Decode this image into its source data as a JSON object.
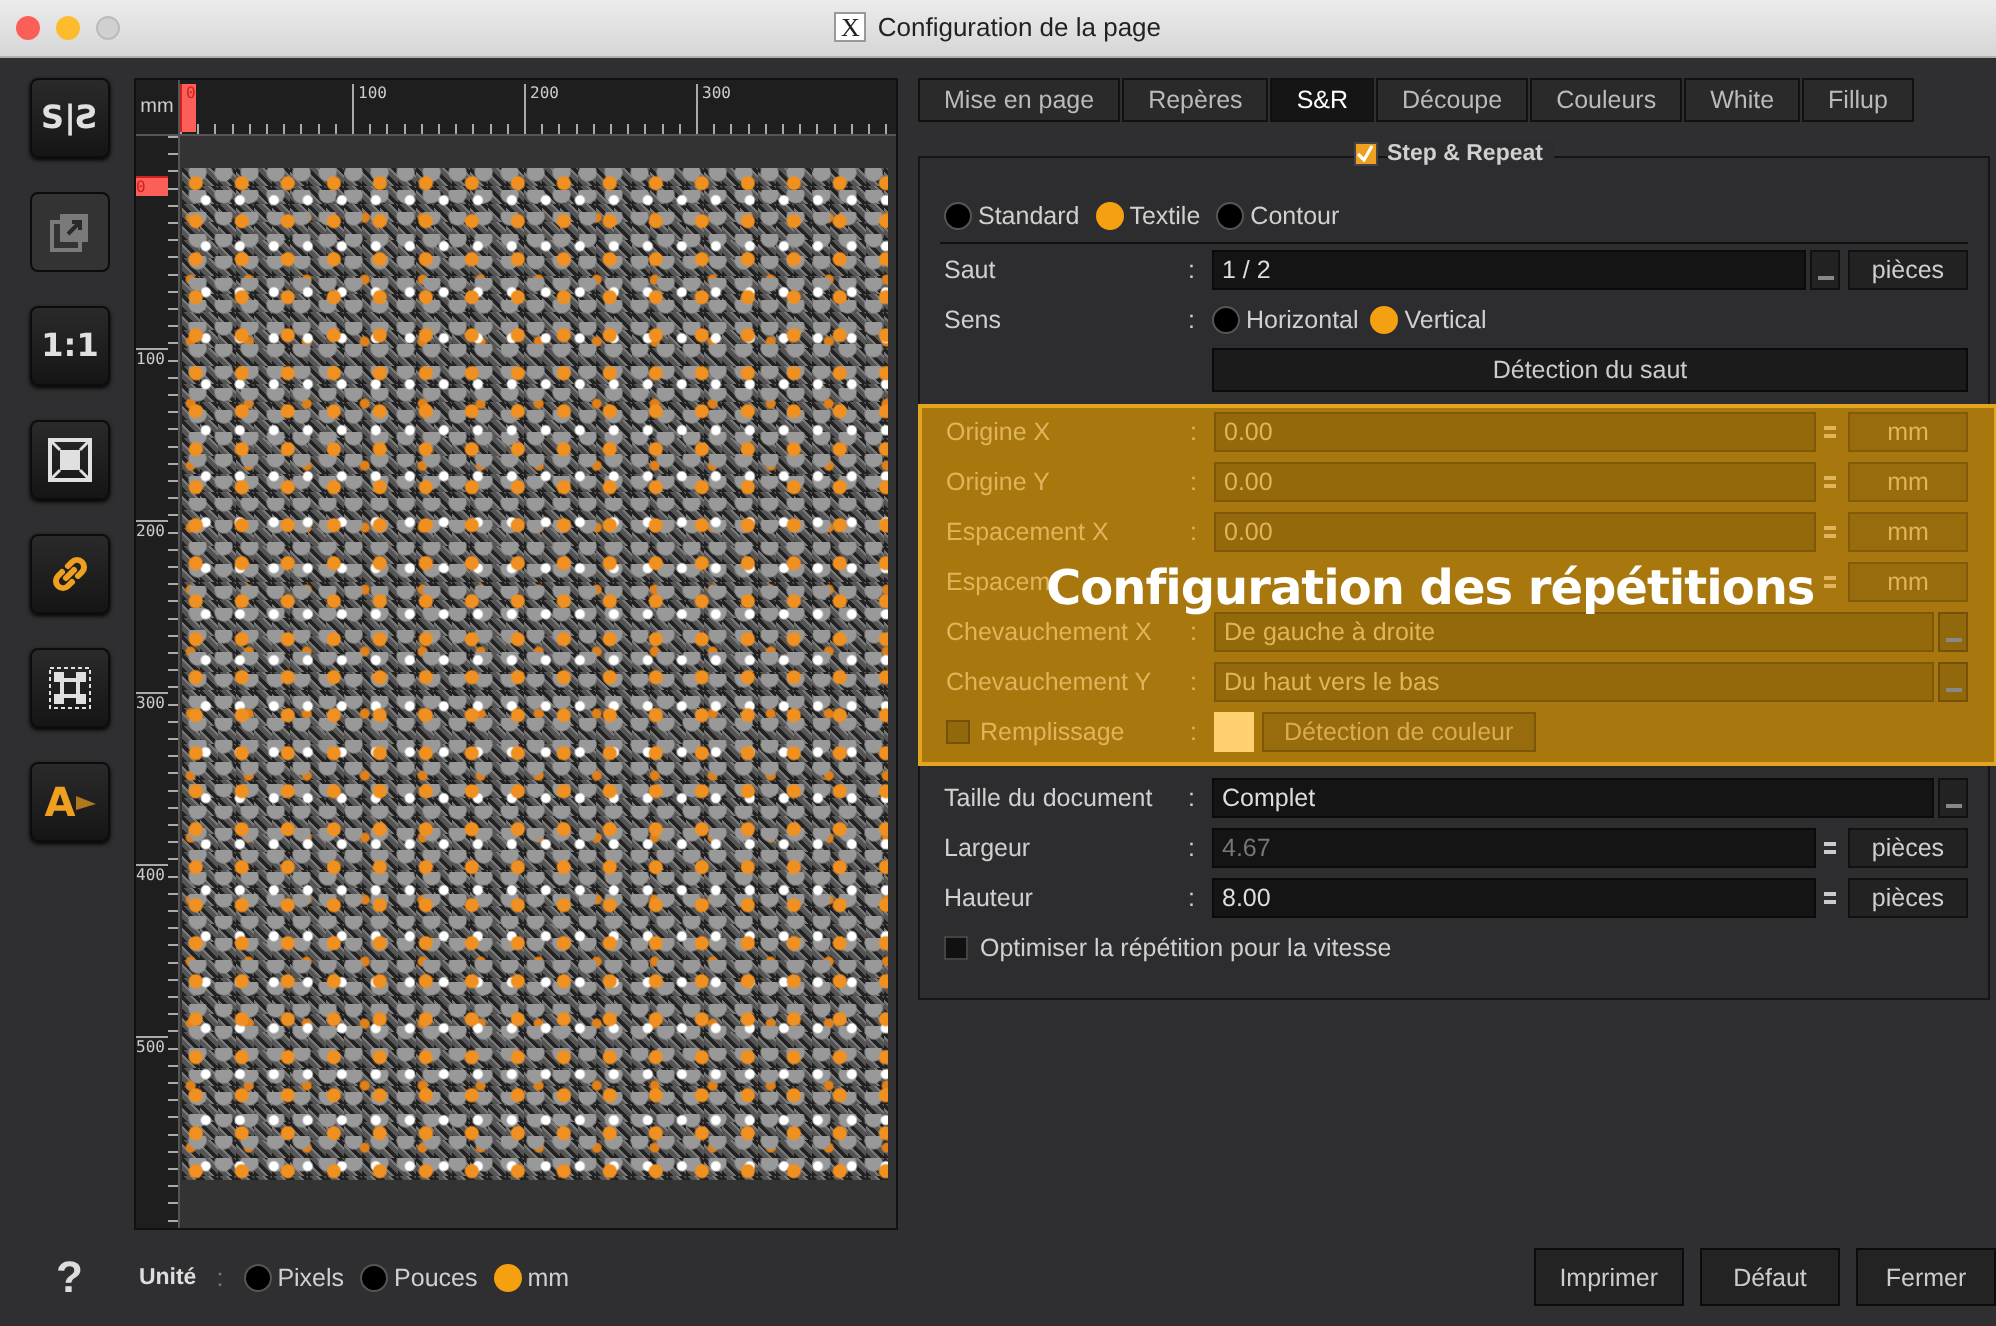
{
  "window": {
    "title": "Configuration de la page",
    "app_glyph": "X"
  },
  "toolbar": [
    {
      "kind": "mirror",
      "label": "S|Ƨ",
      "disabled": false,
      "on": false
    },
    {
      "kind": "export",
      "disabled": true,
      "on": false
    },
    {
      "kind": "actual",
      "label": "1:1",
      "disabled": false,
      "on": false
    },
    {
      "kind": "fit",
      "disabled": false,
      "on": false
    },
    {
      "kind": "link",
      "disabled": false,
      "on": true
    },
    {
      "kind": "frame",
      "disabled": false,
      "on": false
    },
    {
      "kind": "textlayer",
      "label": "A",
      "disabled": false,
      "on": true
    }
  ],
  "ruler": {
    "unit": "mm",
    "top_labels": [
      "0",
      "100",
      "200",
      "300"
    ],
    "left_labels": [
      "0",
      "100",
      "200",
      "300",
      "400",
      "500"
    ]
  },
  "tabs": [
    {
      "label": "Mise en page",
      "selected": false
    },
    {
      "label": "Repères",
      "selected": false
    },
    {
      "label": "S&R",
      "selected": true
    },
    {
      "label": "Découpe",
      "selected": false
    },
    {
      "label": "Couleurs",
      "selected": false
    },
    {
      "label": "White",
      "selected": false
    },
    {
      "label": "Fillup",
      "selected": false
    }
  ],
  "group": {
    "title": "Step & Repeat",
    "checked": true
  },
  "modes": [
    {
      "label": "Standard",
      "selected": false
    },
    {
      "label": "Textile",
      "selected": true
    },
    {
      "label": "Contour",
      "selected": false
    }
  ],
  "rows": [
    {
      "kind": "combo",
      "label": "Saut",
      "colon": ":",
      "value": "1 / 2",
      "unit": "pièces",
      "disabled": false
    },
    {
      "kind": "radios",
      "label": "Sens",
      "colon": ":",
      "options": [
        {
          "label": "Horizontal",
          "selected": false
        },
        {
          "label": "Vertical",
          "selected": true
        }
      ],
      "disabled": false
    },
    {
      "kind": "button",
      "label": "Détection du saut"
    }
  ],
  "highlight_rows": [
    {
      "kind": "spin",
      "label": "Origine X",
      "colon": ":",
      "value": "0.00",
      "unit": "mm",
      "disabled": true
    },
    {
      "kind": "spin",
      "label": "Origine Y",
      "colon": ":",
      "value": "0.00",
      "unit": "mm",
      "disabled": true
    },
    {
      "kind": "spin",
      "label": "Espacement X",
      "colon": ":",
      "value": "0.00",
      "unit": "mm",
      "disabled": true
    },
    {
      "kind": "spin",
      "label": "Espacem",
      "unit": "mm",
      "disabled": true
    },
    {
      "kind": "select",
      "label": "Chevauchement X",
      "colon": ":",
      "value": "De gauche à droite",
      "disabled": true
    },
    {
      "kind": "select",
      "label": "Chevauchement Y",
      "colon": ":",
      "value": "Du haut vers le bas",
      "disabled": true
    },
    {
      "kind": "fill",
      "label": "Remplissage",
      "colon": ":",
      "checked": false,
      "color": "#ffd070",
      "button": "Détection de couleur",
      "disabled": true
    }
  ],
  "callout": "Configuration des répétitions",
  "rows2": [
    {
      "kind": "select",
      "label": "Taille du document",
      "colon": ":",
      "value": "Complet",
      "disabled": false
    },
    {
      "kind": "spin",
      "label": "Largeur",
      "colon": ":",
      "value": "4.67",
      "unit": "pièces",
      "disabled": false,
      "readonly": true
    },
    {
      "kind": "spin",
      "label": "Hauteur",
      "colon": ":",
      "value": "8.00",
      "unit": "pièces",
      "disabled": false,
      "readonly": false
    },
    {
      "kind": "check",
      "label": "Optimiser la répétition pour la vitesse",
      "checked": false,
      "disabled": false
    }
  ],
  "help": "?",
  "units": {
    "label": "Unité",
    "colon": ":",
    "options": [
      {
        "label": "Pixels",
        "selected": false
      },
      {
        "label": "Pouces",
        "selected": false
      },
      {
        "label": "mm",
        "selected": true
      }
    ]
  },
  "buttons": [
    "Imprimer",
    "Défaut",
    "Fermer"
  ]
}
